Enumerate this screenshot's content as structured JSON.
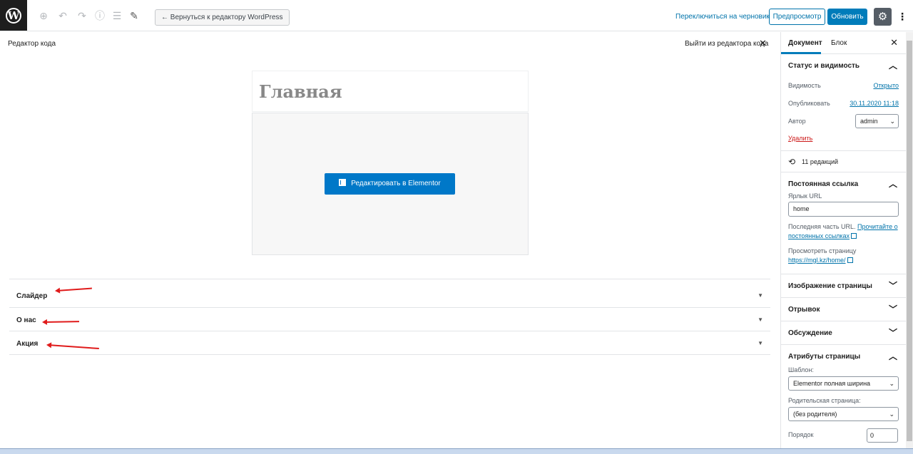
{
  "toolbar": {
    "back_label": "← Вернуться к редактору WordPress",
    "switch_draft": "Переключиться на черновик",
    "preview": "Предпросмотр",
    "update": "Обновить"
  },
  "editor": {
    "code_editor_label": "Редактор кода",
    "exit_code_editor": "Выйти из редактора кода",
    "post_title": "Главная",
    "elementor_button": "Редактировать в Elementor"
  },
  "sections": [
    {
      "label": "Слайдер"
    },
    {
      "label": "О нас"
    },
    {
      "label": "Акция"
    }
  ],
  "sidebar": {
    "tabs": [
      "Документ",
      "Блок"
    ],
    "status": {
      "title": "Статус и видимость",
      "visibility_label": "Видимость",
      "visibility_value": "Открыто",
      "publish_label": "Опубликовать",
      "publish_value": "30.11.2020 11:18",
      "author_label": "Автор",
      "author_value": "admin",
      "delete": "Удалить"
    },
    "revisions": "11 редакций",
    "permalink": {
      "title": "Постоянная ссылка",
      "slug_label": "Ярлык URL",
      "slug_value": "home",
      "desc_prefix": "Последняя часть URL.",
      "desc_link": "Прочитайте о постоянных ссылках",
      "view_label": "Просмотреть страницу",
      "view_url": "https://mgl.kz/home/"
    },
    "featured_image": "Изображение страницы",
    "excerpt": "Отрывок",
    "discussion": "Обсуждение",
    "page_attributes": {
      "title": "Атрибуты страницы",
      "template_label": "Шаблон:",
      "template_value": "Elementor полная ширина",
      "parent_label": "Родительская страница:",
      "parent_value": "(без родителя)",
      "order_label": "Порядок",
      "order_value": "0"
    }
  },
  "colors": {
    "primary": "#007cba",
    "link": "#0073aa",
    "elementor": "#0078c8",
    "annotation": "#e01b1b"
  }
}
